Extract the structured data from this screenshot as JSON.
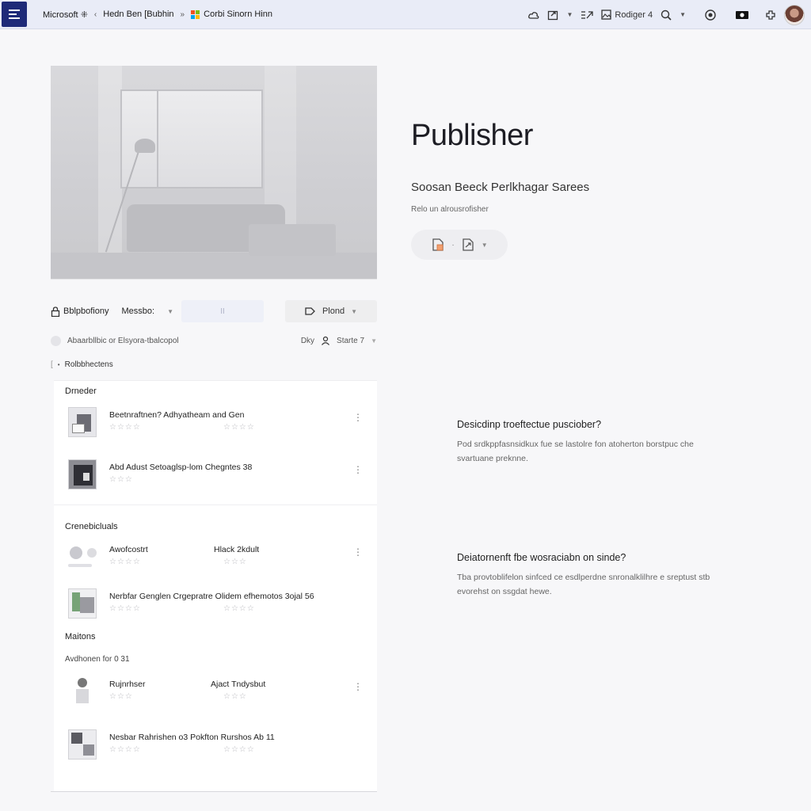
{
  "topbar": {
    "crumb1": "Microsoft",
    "crumb1_suffix": "⁜",
    "crumb2": "Hedn Ben [Bubhin",
    "crumb3": "Corbi Sinorn Hinn",
    "reader_label": "Rodiger 4",
    "brand_colors": [
      "#f25022",
      "#7fba00",
      "#00a4ef",
      "#ffb900"
    ]
  },
  "left": {
    "controls": {
      "label": "Bblpbofiony",
      "dropdown": "Messbo:",
      "field_value": "II",
      "plan_button": "Plond"
    },
    "filter": {
      "text": "Abaarbllbic or Elsyora-tbalcopol",
      "right1": "Dky",
      "right2": "Starte 7"
    },
    "section_title": "Rolbbhectens",
    "groups": [
      {
        "name": "Drneder",
        "items": [
          {
            "title": "Beetnraftnen? Adhyatheam and Gen",
            "alt": "",
            "stars": "☆☆☆☆",
            "stars2": "☆☆☆☆"
          },
          {
            "title": "Abd Adust Setoaglsp-lom Chegntes 38",
            "alt": "",
            "stars": "☆☆☆",
            "stars2": ""
          }
        ]
      },
      {
        "name": "Crenebicluals",
        "items": [
          {
            "title": "Awofcostrt",
            "alt": "Hlack 2kdult",
            "stars": "☆☆☆☆",
            "stars2": "☆☆☆"
          },
          {
            "title": "Nerbfar Genglen Crgepratre Olidem efhemotos 3ojal 56",
            "alt": "",
            "stars": "☆☆☆☆",
            "stars2": "☆☆☆☆"
          }
        ]
      },
      {
        "name": "Maitons",
        "sub": "Avdhonen for 0 31",
        "items": [
          {
            "title": "Rujnrhser",
            "alt": "Ajact Tndysbut",
            "stars": "☆☆☆",
            "stars2": "☆☆☆"
          },
          {
            "title": "Nesbar Rahrishen o3 Pokfton Rurshos Ab 11",
            "alt": "",
            "stars": "☆☆☆☆",
            "stars2": "☆☆☆☆"
          }
        ]
      }
    ]
  },
  "right": {
    "title": "Publisher",
    "subtitle": "Soosan Beeck Perlkhagar Sarees",
    "small": "Relo un alrousrofisher",
    "faq": [
      {
        "q": "Desicdinp troeftectue pusciober?",
        "a": "Pod srdkppfasnsidkux fue se lastolre fon atoherton borstpuc che svartuane preknne."
      },
      {
        "q": "Deiatornenft fbe wosraciabn on sinde?",
        "a": "Tba provtoblifelon sinfced ce esdlperdne snronalklilhre e sreptust stb evorehst on ssgdat hewe."
      }
    ]
  }
}
